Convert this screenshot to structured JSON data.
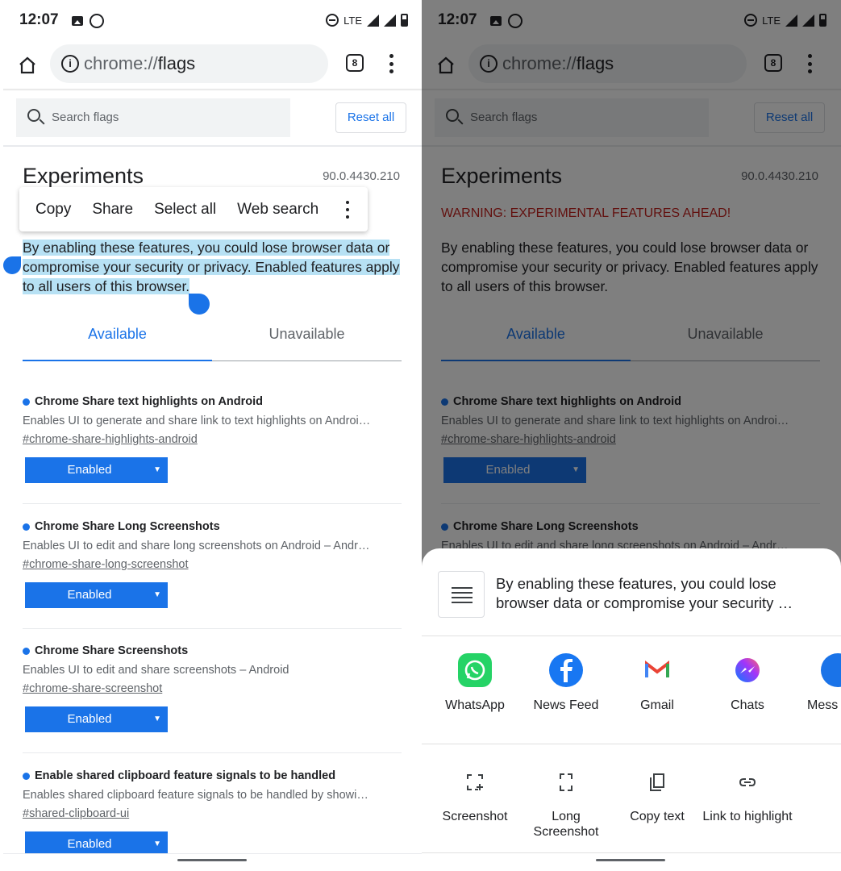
{
  "status": {
    "time": "12:07",
    "network": "LTE"
  },
  "toolbar": {
    "url_scheme": "chrome://",
    "url_host": "flags",
    "tab_count": "8"
  },
  "search": {
    "placeholder": "Search flags",
    "reset_label": "Reset all"
  },
  "page": {
    "title": "Experiments",
    "version": "90.0.4430.210",
    "warning": "WARNING: EXPERIMENTAL FEATURES AHEAD!",
    "description": "By enabling these features, you could lose browser data or compromise your security or privacy. Enabled features apply to all users of this browser."
  },
  "context_menu": {
    "copy": "Copy",
    "share": "Share",
    "select_all": "Select all",
    "web_search": "Web search"
  },
  "tabs": {
    "available": "Available",
    "unavailable": "Unavailable"
  },
  "flags": [
    {
      "title": "Chrome Share text highlights on Android",
      "desc": "Enables UI to generate and share link to text highlights on Androi…",
      "link": "#chrome-share-highlights-android",
      "value": "Enabled"
    },
    {
      "title": "Chrome Share Long Screenshots",
      "desc": "Enables UI to edit and share long screenshots on Android – Andr…",
      "link": "#chrome-share-long-screenshot",
      "value": "Enabled"
    },
    {
      "title": "Chrome Share Screenshots",
      "desc": "Enables UI to edit and share screenshots – Android",
      "link": "#chrome-share-screenshot",
      "value": "Enabled"
    },
    {
      "title": "Enable shared clipboard feature signals to be handled",
      "desc": "Enables shared clipboard feature signals to be handled by showi…",
      "link": "#shared-clipboard-ui",
      "value": "Enabled"
    }
  ],
  "share_sheet": {
    "preview_text": "By enabling these features, you could lose browser data or compromise your security …",
    "apps": [
      {
        "label": "WhatsApp",
        "icon": "whatsapp-icon",
        "color": "#25d366"
      },
      {
        "label": "News Feed",
        "icon": "facebook-icon",
        "color": "#1877f2"
      },
      {
        "label": "Gmail",
        "icon": "gmail-icon",
        "color": "#ea4335"
      },
      {
        "label": "Chats",
        "icon": "messenger-icon",
        "color": "#a334fa"
      },
      {
        "label": "Mess",
        "icon": "messages-icon",
        "color": "#1a73e8"
      }
    ],
    "actions": [
      {
        "label": "Screenshot",
        "icon": "screenshot-icon"
      },
      {
        "label": "Long Screenshot",
        "icon": "long-screenshot-icon"
      },
      {
        "label": "Copy text",
        "icon": "copy-icon"
      },
      {
        "label": "Link to highlight",
        "icon": "link-icon"
      }
    ]
  },
  "colors": {
    "accent": "#1a73e8",
    "warning": "#c5221f",
    "highlight": "#b7e1f4"
  }
}
